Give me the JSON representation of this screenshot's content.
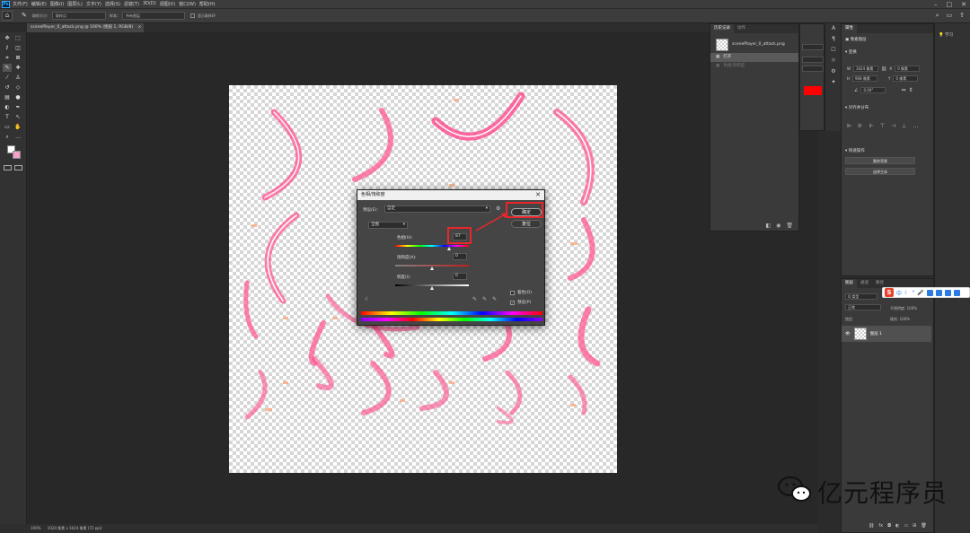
{
  "menubar": {
    "app_logo": "Ps",
    "items": [
      "文件(F)",
      "编辑(E)",
      "图像(I)",
      "图层(L)",
      "文字(Y)",
      "选择(S)",
      "滤镜(T)",
      "3D(D)",
      "视图(V)",
      "窗口(W)",
      "帮助(H)"
    ]
  },
  "options_bar": {
    "sample_size_label": "取样大小:",
    "sample_size_value": "取样点",
    "sample_label": "样本:",
    "sample_value": "所有图层",
    "show_ring": "显示取样环"
  },
  "document": {
    "tab_label": "scenePlayer_0_attack.png @ 100% (图层 1, RGB/8)"
  },
  "status_bar": {
    "zoom": "100%",
    "info": "1024 像素 x 1024 像素 (72 ppi)"
  },
  "history_panel": {
    "tabs": [
      "历史记录",
      "动作"
    ],
    "snapshot": "scenePlayer_0_attack.png",
    "steps": [
      {
        "label": "打开",
        "selected": true
      },
      {
        "label": "色相/饱和度",
        "selected": false
      }
    ]
  },
  "properties_panel": {
    "tab": "属性",
    "pixel_layer": "像素图层",
    "transform_header": "变换",
    "w_label": "W",
    "w_value": "1024 像素",
    "x_label": "X",
    "x_value": "0 像素",
    "h_label": "H",
    "h_value": "908 像素",
    "y_label": "Y",
    "y_value": "0 像素",
    "angle_value": "0.00°",
    "align_header": "对齐并分布",
    "quick_header": "快速操作",
    "remove_bg": "删除背景",
    "select_subject": "选择主体"
  },
  "learn_panel": {
    "label": "学习"
  },
  "layers_panel": {
    "tabs": [
      "图层",
      "通道",
      "路径"
    ],
    "kind_label": "Q 类型",
    "mode_label": "正常",
    "opacity_label": "不透明度: 100%",
    "lock_label": "锁定:",
    "fill_label": "填充: 100%",
    "layer_name": "图层 1"
  },
  "dialog": {
    "title": "色相/饱和度",
    "preset_label": "预设(E):",
    "preset_value": "自定",
    "channel": "全图",
    "hue_label": "色相(H):",
    "hue_value": "87",
    "sat_label": "饱和度(A):",
    "sat_value": "0",
    "light_label": "明度(I):",
    "light_value": "0",
    "ok_label": "确定",
    "reset_label": "复位",
    "colorize_label": "着色(O)",
    "preview_label": "预览(P)",
    "preview_checked": true,
    "colorize_checked": false
  },
  "watermark": {
    "text": "亿元程序员"
  },
  "colors": {
    "highlight": "#e8262b",
    "fg_swatch": "#ffffff",
    "bg_swatch": "#f4a0c8",
    "red_swatch": "#ff0000"
  }
}
